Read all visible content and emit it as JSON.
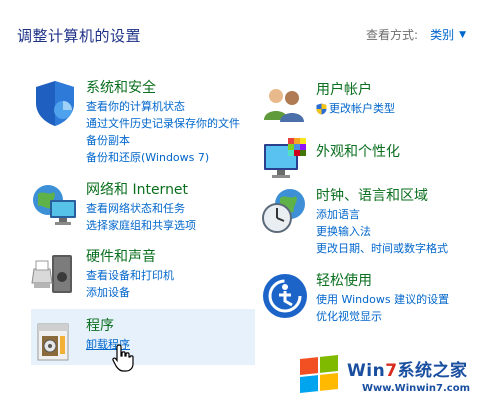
{
  "header": {
    "title": "调整计算机的设置",
    "view_by_label": "查看方式:",
    "view_by_value": "类别"
  },
  "categories": {
    "system": {
      "title": "系统和安全",
      "links": [
        "查看你的计算机状态",
        "通过文件历史记录保存你的文件备份副本",
        "备份和还原(Windows 7)"
      ]
    },
    "network": {
      "title": "网络和 Internet",
      "links": [
        "查看网络状态和任务",
        "选择家庭组和共享选项"
      ]
    },
    "hardware": {
      "title": "硬件和声音",
      "links": [
        "查看设备和打印机",
        "添加设备"
      ]
    },
    "programs": {
      "title": "程序",
      "links": [
        "卸载程序"
      ]
    },
    "users": {
      "title": "用户帐户",
      "links": [
        "更改帐户类型"
      ]
    },
    "appearance": {
      "title": "外观和个性化",
      "links": []
    },
    "clock": {
      "title": "时钟、语言和区域",
      "links": [
        "添加语言",
        "更换输入法",
        "更改日期、时间或数字格式"
      ]
    },
    "ease": {
      "title": "轻松使用",
      "links": [
        "使用 Windows 建议的设置",
        "优化视觉显示"
      ]
    }
  },
  "watermark": {
    "brand_win": "Win",
    "brand_seven": "7",
    "brand_rest": "系统之家",
    "url": "Www.Winwin7.com"
  },
  "colors": {
    "title_blue": "#1e3287",
    "category_green": "#0a6f1e",
    "link_blue": "#0066cc",
    "hover_bg": "#e6f1fb"
  }
}
